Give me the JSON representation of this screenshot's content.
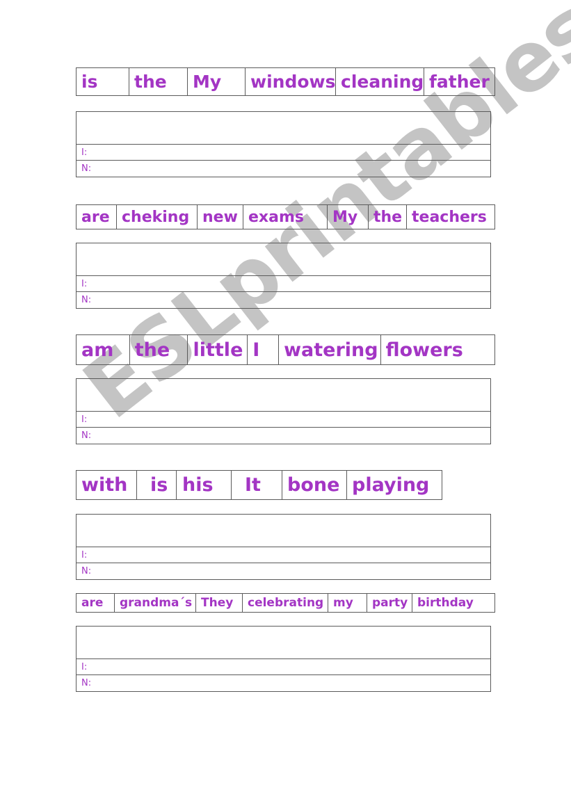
{
  "watermark": "ESLprintables.com",
  "colors": {
    "word_text": "#a335c4",
    "border": "#5a5a5a",
    "watermark": "#c4c4c4"
  },
  "exercises": [
    {
      "words": [
        "is",
        "the",
        "My",
        "windows",
        "cleaning",
        "father"
      ],
      "label_i": "I:",
      "label_n": "N:"
    },
    {
      "words": [
        "are",
        "cheking",
        "new",
        "exams",
        "My",
        "the",
        "teachers"
      ],
      "label_i": "I:",
      "label_n": "N:"
    },
    {
      "words": [
        "am",
        "the",
        "little",
        "I",
        "watering",
        "flowers"
      ],
      "label_i": "I:",
      "label_n": "N:"
    },
    {
      "words": [
        "with",
        "is",
        "his",
        "It",
        "bone",
        "playing"
      ],
      "label_i": "I:",
      "label_n": "N:"
    },
    {
      "words": [
        "are",
        "grandma´s",
        "They",
        "celebrating",
        "my",
        "party",
        "birthday"
      ],
      "label_i": "I:",
      "label_n": "N:"
    }
  ]
}
